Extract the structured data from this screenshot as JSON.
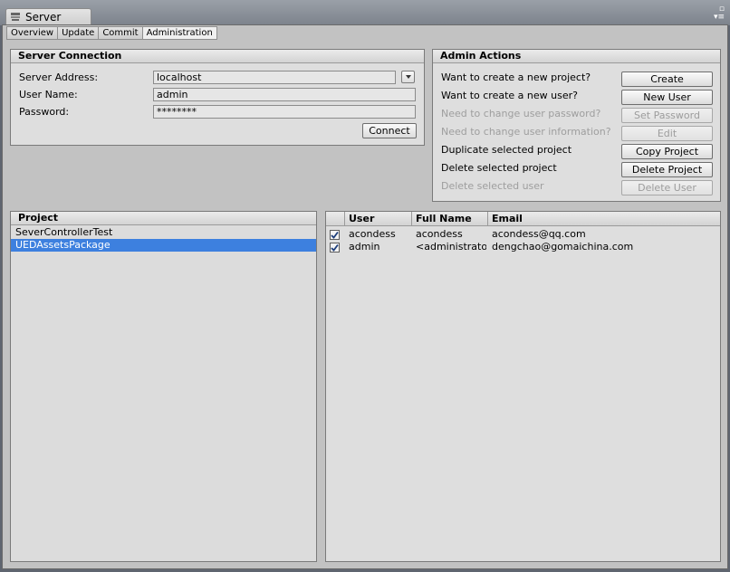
{
  "window": {
    "title": "Server",
    "tabs": [
      "Overview",
      "Update",
      "Commit",
      "Administration"
    ],
    "active_tab": "Administration"
  },
  "server_connection": {
    "title": "Server Connection",
    "address_label": "Server Address:",
    "address_value": "localhost",
    "username_label": "User Name:",
    "username_value": "admin",
    "password_label": "Password:",
    "password_value": "********",
    "connect_label": "Connect"
  },
  "admin_actions": {
    "title": "Admin Actions",
    "rows": [
      {
        "label": "Want to create a new project?",
        "button": "Create",
        "enabled": true
      },
      {
        "label": "Want to create a new user?",
        "button": "New User",
        "enabled": true
      },
      {
        "label": "Need to change user password?",
        "button": "Set Password",
        "enabled": false
      },
      {
        "label": "Need to change user information?",
        "button": "Edit",
        "enabled": false
      },
      {
        "label": "Duplicate selected project",
        "button": "Copy Project",
        "enabled": true
      },
      {
        "label": "Delete selected project",
        "button": "Delete Project",
        "enabled": true
      },
      {
        "label": "Delete selected user",
        "button": "Delete User",
        "enabled": false
      }
    ]
  },
  "projects": {
    "header": "Project",
    "items": [
      {
        "name": "SeverControllerTest",
        "selected": false
      },
      {
        "name": "UEDAssetsPackage",
        "selected": true
      }
    ]
  },
  "users": {
    "headers": [
      "User",
      "Full Name",
      "Email"
    ],
    "rows": [
      {
        "checked": true,
        "user": "acondess",
        "full_name": "acondess",
        "email": "acondess@qq.com"
      },
      {
        "checked": true,
        "user": "admin",
        "full_name": "<administrator>",
        "email": "dengchao@gomaichina.com"
      }
    ]
  },
  "colors": {
    "selection": "#3d80df",
    "panel_bg": "#dedede",
    "window_bg": "#c2c2c2"
  }
}
